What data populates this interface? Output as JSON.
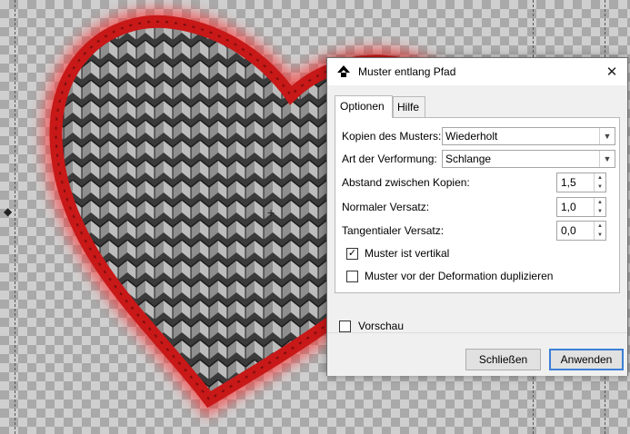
{
  "dialog": {
    "title": "Muster entlang Pfad",
    "close_symbol": "✕",
    "tabs": [
      {
        "label": "Optionen"
      },
      {
        "label": "Hilfe"
      }
    ],
    "fields": {
      "copies": {
        "label": "Kopien des Musters:",
        "value": "Wiederholt"
      },
      "deformation": {
        "label": "Art der Verformung:",
        "value": "Schlange"
      },
      "spacing": {
        "label": "Abstand zwischen Kopien:",
        "value": "1,5"
      },
      "normal_offset": {
        "label": "Normaler Versatz:",
        "value": "1,0"
      },
      "tangential_offset": {
        "label": "Tangentialer Versatz:",
        "value": "0,0"
      }
    },
    "checkboxes": {
      "vertical": {
        "label": "Muster ist vertikal",
        "checked": true
      },
      "duplicate": {
        "label": "Muster vor der Deformation duplizieren",
        "checked": false
      },
      "preview": {
        "label": "Vorschau",
        "checked": false
      }
    },
    "buttons": {
      "close": "Schließen",
      "apply": "Anwenden"
    }
  },
  "canvas": {
    "heart_outline_color": "#d42020",
    "knit_color": "#8a8a8a"
  },
  "icons": {
    "app": "inkscape-icon",
    "dropdown": "chevron-down-icon",
    "spin_up": "arrow-up-icon",
    "spin_down": "arrow-down-icon",
    "checkmark": "checkmark-icon"
  }
}
